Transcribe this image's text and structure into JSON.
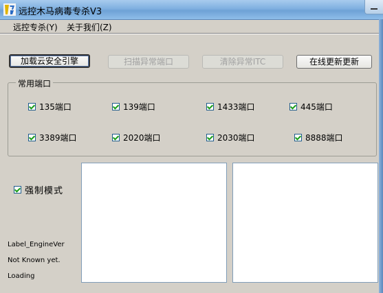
{
  "window": {
    "title": "远控木马病毒专杀V3"
  },
  "menu": [
    {
      "label": "远控专杀(Y)"
    },
    {
      "label": "关于我们(Z)"
    }
  ],
  "buttons": {
    "load_engine": "加载云安全引擎",
    "scan_ports": "扫描异常端口",
    "clear_itc": "清除异常ITC",
    "update": "在线更新更新"
  },
  "ports_group": {
    "title": "常用端口",
    "ports": [
      {
        "label": "135端口",
        "checked": true
      },
      {
        "label": "139端口",
        "checked": true
      },
      {
        "label": "1433端口",
        "checked": true
      },
      {
        "label": "445端口",
        "checked": true
      },
      {
        "label": "3389端口",
        "checked": true
      },
      {
        "label": "2020端口",
        "checked": true
      },
      {
        "label": "2030端口",
        "checked": true
      },
      {
        "label": "8888端口",
        "checked": true
      }
    ]
  },
  "force_mode": {
    "label": "强制模式",
    "checked": true
  },
  "status": {
    "engine_version": "Label_EngineVer",
    "known": "Not Known yet.",
    "loading": "Loading"
  }
}
